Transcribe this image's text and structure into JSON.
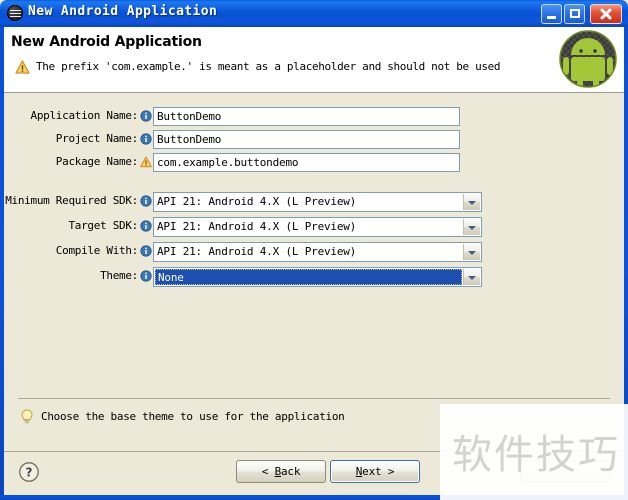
{
  "window": {
    "title": "New Android Application",
    "icon": "eclipse-wizard-icon",
    "minimize_label": "Minimize",
    "maximize_label": "Maximize",
    "close_label": "Close"
  },
  "header": {
    "title": "New Android Application",
    "message": "The prefix 'com.example.' is meant as a placeholder and should not be used",
    "message_icon": "warning-icon",
    "logo": "android-robot-logo"
  },
  "form": {
    "fields": [
      {
        "label": "Application Name:",
        "icon": "info-icon",
        "type": "text",
        "value": "ButtonDemo"
      },
      {
        "label": "Project Name:",
        "icon": "info-icon",
        "type": "text",
        "value": "ButtonDemo"
      },
      {
        "label": "Package Name:",
        "icon": "warning-icon",
        "type": "text",
        "value": "com.example.buttondemo"
      },
      {
        "label": "Minimum Required SDK:",
        "icon": "info-icon",
        "type": "combo",
        "value": "API 21: Android 4.X (L Preview)",
        "selected": false
      },
      {
        "label": "Target SDK:",
        "icon": "info-icon",
        "type": "combo",
        "value": "API 21: Android 4.X (L Preview)",
        "selected": false
      },
      {
        "label": "Compile With:",
        "icon": "info-icon",
        "type": "combo",
        "value": "API 21: Android 4.X (L Preview)",
        "selected": false
      },
      {
        "label": "Theme:",
        "icon": "info-icon",
        "type": "combo",
        "value": "None",
        "selected": true
      }
    ]
  },
  "hint": {
    "icon": "lightbulb-icon",
    "text": "Choose the base theme to use for the application"
  },
  "buttonbar": {
    "help_icon": "help-question-icon",
    "back": "< Back",
    "back_prefix": "< ",
    "back_mnemonic": "B",
    "back_suffix": "ack",
    "next_prefix": "",
    "next_mnemonic": "N",
    "next_suffix": "ext >",
    "cancel": ""
  },
  "watermark": {
    "text": "软件技巧"
  },
  "colors": {
    "title_blue": "#0B52DE",
    "dialog_bg": "#ECE9D8",
    "field_border": "#7F9DB9",
    "selection_blue": "#1C4FAF",
    "android_green": "#A4C639",
    "warning_orange": "#F0A830",
    "info_blue": "#3C78B4"
  }
}
